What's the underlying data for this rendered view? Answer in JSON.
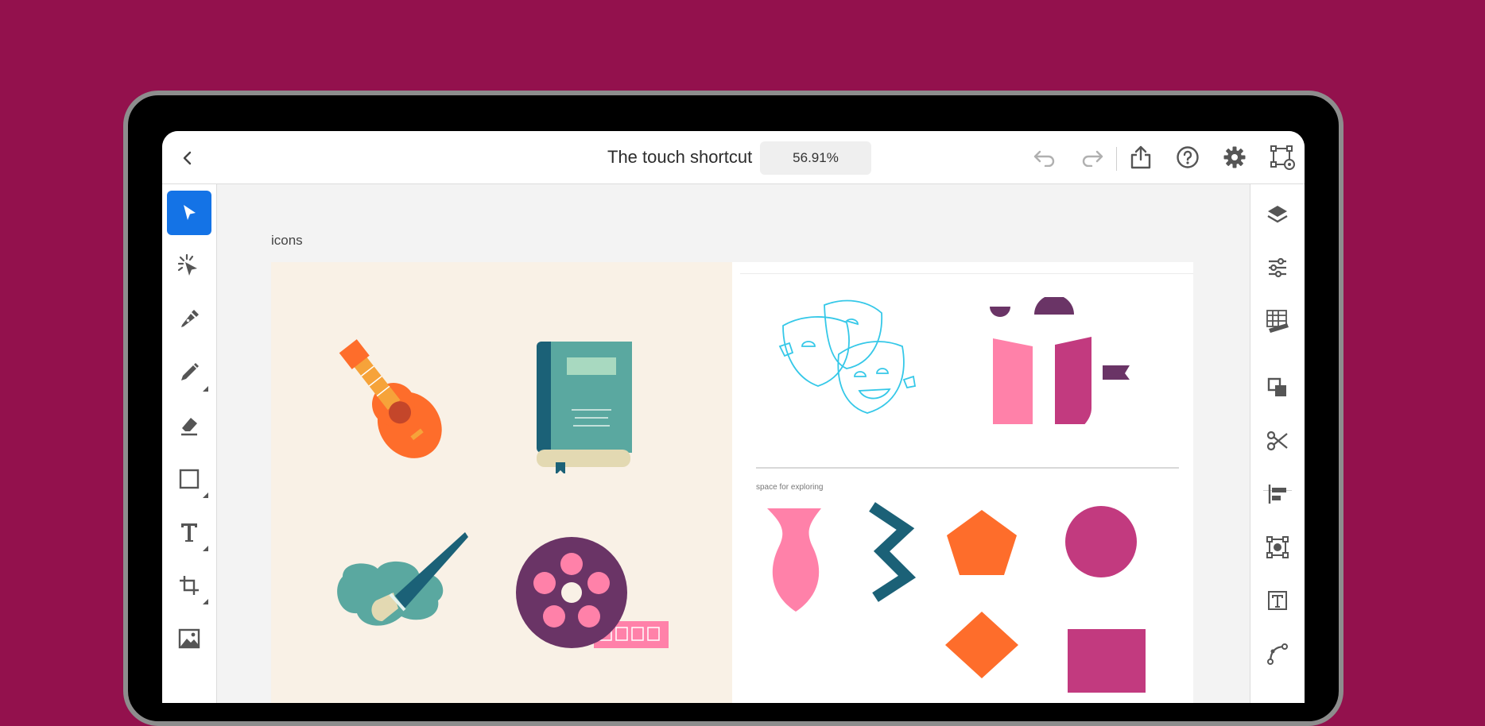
{
  "app": {
    "document_title": "The touch shortcut",
    "zoom": "56.91%"
  },
  "canvas": {
    "artboard_label": "icons",
    "explore_label": "space for exploring"
  },
  "left_tools": [
    {
      "name": "select-tool",
      "icon": "arrow-icon",
      "active": true
    },
    {
      "name": "direct-select-tool",
      "icon": "direct-select-icon"
    },
    {
      "name": "pen-tool",
      "icon": "pen-icon"
    },
    {
      "name": "pencil-tool",
      "icon": "pencil-icon"
    },
    {
      "name": "eraser-tool",
      "icon": "eraser-icon"
    },
    {
      "name": "rectangle-tool",
      "icon": "rectangle-icon"
    },
    {
      "name": "type-tool",
      "icon": "type-icon"
    },
    {
      "name": "transform-tool",
      "icon": "transform-icon"
    },
    {
      "name": "image-tool",
      "icon": "image-icon"
    }
  ],
  "right_tools": [
    {
      "name": "layers-button",
      "icon": "layers-icon"
    },
    {
      "name": "properties-button",
      "icon": "sliders-icon"
    },
    {
      "name": "grid-button",
      "icon": "grid-ruler-icon"
    },
    {
      "name": "arrange-button",
      "icon": "arrange-icon"
    },
    {
      "name": "cut-button",
      "icon": "scissors-icon"
    },
    {
      "name": "align-button",
      "icon": "align-left-icon"
    },
    {
      "name": "transform-button",
      "icon": "transform-box-icon"
    },
    {
      "name": "type-properties-button",
      "icon": "type-box-icon"
    },
    {
      "name": "path-button",
      "icon": "path-icon"
    }
  ],
  "colors": {
    "background": "#93114d",
    "accent": "#1473e6",
    "artboard_cream": "#f9f1e6",
    "orange": "#fe6d2b",
    "pink": "#ff81a9",
    "magenta": "#c23a7f",
    "teal": "#5aa8a0",
    "dark_teal": "#1b6177",
    "purple": "#6a3466",
    "cyan_outline": "#35c8e8"
  }
}
